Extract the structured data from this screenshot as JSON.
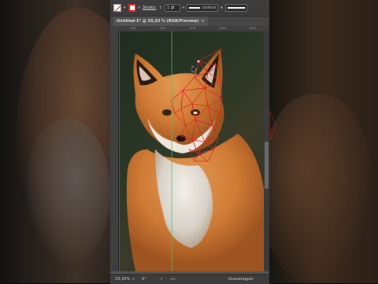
{
  "options_bar": {
    "stroke_label": "Stroke:",
    "stroke_weight": "1 pt",
    "stroke_style": "Uniform"
  },
  "document_tab": {
    "title": "Untitled-1* @ 33,33 % (RGB/Preview)",
    "close": "×"
  },
  "ruler": {
    "ticks": [
      "1000",
      "1200",
      "1400",
      "1600",
      "1800"
    ]
  },
  "status_bar": {
    "zoom": "33,33%",
    "rotation": "0°",
    "tool": "Grasshopper"
  },
  "colors": {
    "accent_stroke": "#e02020",
    "guide_line": "#33cc66"
  }
}
